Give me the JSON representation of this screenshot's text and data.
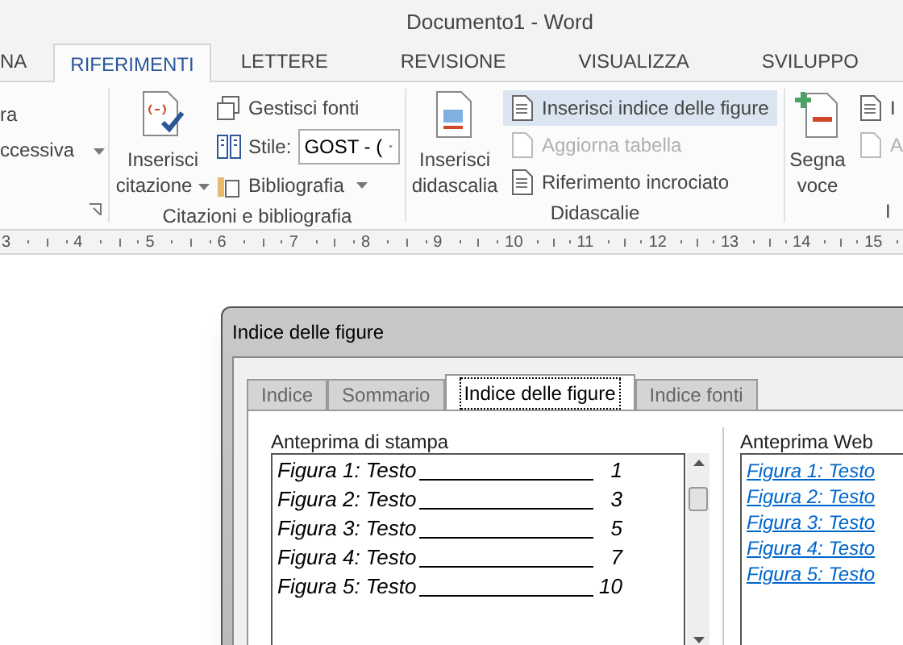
{
  "window": {
    "title": "Documento1 - Word"
  },
  "tabs": [
    {
      "label": "NA",
      "selected": false
    },
    {
      "label": "RIFERIMENTI",
      "selected": true
    },
    {
      "label": "LETTERE",
      "selected": false
    },
    {
      "label": "REVISIONE",
      "selected": false
    },
    {
      "label": "VISUALIZZA",
      "selected": false
    },
    {
      "label": "SVILUPPO",
      "selected": false
    }
  ],
  "ribbon": {
    "group_1": {
      "items": [
        "ra",
        "ccessiva"
      ]
    },
    "citazioni": {
      "label": "Citazioni e bibliografia",
      "large_button": "Inserisci citazione",
      "manage_sources": "Gestisci fonti",
      "style_label": "Stile:",
      "style_value": "GOST - (",
      "bibliography": "Bibliografia"
    },
    "didascalie": {
      "label": "Didascalie",
      "large_button": "Inserisci didascalia",
      "commands": [
        {
          "label": "Inserisci indice delle figure",
          "highlighted": true,
          "disabled": false
        },
        {
          "label": "Aggiorna tabella",
          "highlighted": false,
          "disabled": true
        },
        {
          "label": "Riferimento incrociato",
          "highlighted": false,
          "disabled": false
        }
      ]
    },
    "group_4": {
      "label": "I",
      "large_button": "Segna voce",
      "commands": [
        {
          "label": "I",
          "disabled": false
        },
        {
          "label": "A",
          "disabled": true
        }
      ]
    }
  },
  "ruler_numbers": [
    "3",
    "4",
    "5",
    "6",
    "7",
    "8",
    "9",
    "10",
    "11",
    "12",
    "13",
    "14",
    "15"
  ],
  "dialog": {
    "title": "Indice delle figure",
    "tabs": [
      {
        "label": "Indice",
        "selected": false
      },
      {
        "label": "Sommario",
        "selected": false
      },
      {
        "label": "Indice delle figure",
        "selected": true
      },
      {
        "label": "Indice fonti",
        "selected": false
      }
    ],
    "print_preview": {
      "label": "Anteprima di stampa",
      "entries": [
        {
          "caption": "Figura 1: Testo",
          "page": "1"
        },
        {
          "caption": "Figura 2: Testo",
          "page": "3"
        },
        {
          "caption": "Figura 3: Testo",
          "page": "5"
        },
        {
          "caption": "Figura 4: Testo",
          "page": "7"
        },
        {
          "caption": "Figura 5: Testo",
          "page": "10"
        }
      ]
    },
    "web_preview": {
      "label": "Anteprima Web",
      "links": [
        "Figura 1: Testo",
        "Figura 2: Testo",
        "Figura 3: Testo",
        "Figura 4: Testo",
        "Figura 5: Testo"
      ]
    }
  }
}
